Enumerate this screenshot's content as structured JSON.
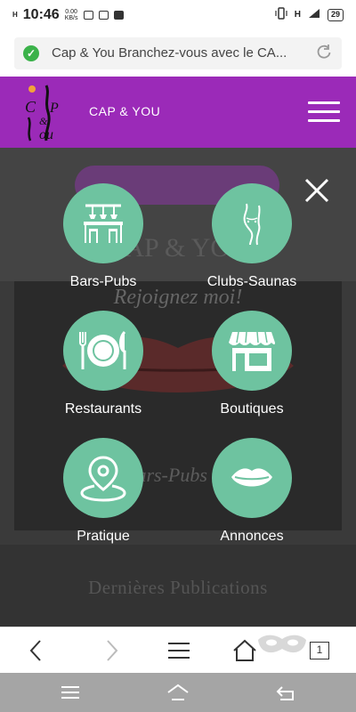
{
  "status_bar": {
    "network": "H",
    "time": "10:46",
    "speed_value": "0.00",
    "speed_unit": "KB/s",
    "network_right": "H",
    "battery": "29"
  },
  "browser": {
    "url_text": "Cap & You Branchez-vous avec le CA...",
    "tab_count": "1"
  },
  "header": {
    "title": "CAP & YOU",
    "logo_text": "CAP & You"
  },
  "background": {
    "heading": "CAP & YOU",
    "tagline": "Rejoignez moi!",
    "pub_text": "Bars-Pubs",
    "latest": "Dernières Publications"
  },
  "menu": {
    "items": [
      {
        "label": "Bars-Pubs",
        "icon": "bar-icon"
      },
      {
        "label": "Clubs-Saunas",
        "icon": "body-icon"
      },
      {
        "label": "Restaurants",
        "icon": "restaurant-icon"
      },
      {
        "label": "Boutiques",
        "icon": "shop-icon"
      },
      {
        "label": "Pratique",
        "icon": "location-icon"
      },
      {
        "label": "Annonces",
        "icon": "lips-icon"
      }
    ]
  },
  "colors": {
    "header": "#9b2ab8",
    "menu_circle": "#6ec3a0",
    "secure": "#3bb24a"
  }
}
